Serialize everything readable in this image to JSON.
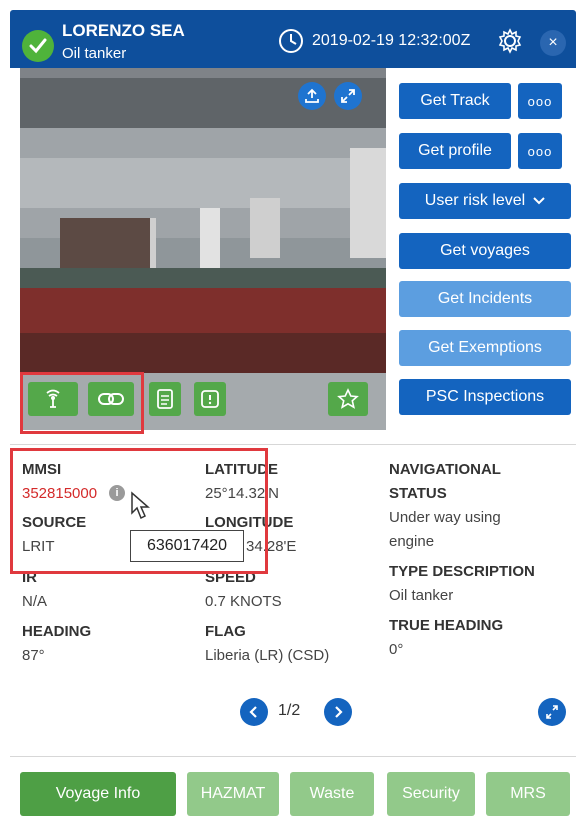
{
  "header": {
    "vessel_name": "LORENZO SEA",
    "vessel_type": "Oil tanker",
    "timestamp": "2019-02-19 12:32:00Z",
    "icons": [
      "check-icon",
      "clock-icon",
      "gear-icon",
      "close-icon"
    ],
    "close_glyph": "×"
  },
  "photo": {
    "overlay_icons": [
      "upload-icon",
      "expand-icon"
    ],
    "tool_icons": [
      "antenna-icon",
      "link-icon",
      "document-icon",
      "info-square-icon",
      "star-icon"
    ]
  },
  "actions": {
    "get_track": "Get Track",
    "get_profile": "Get profile",
    "more_glyph": "ooo",
    "user_risk_level": "User risk level",
    "get_voyages": "Get voyages",
    "get_incidents": "Get Incidents",
    "get_exemptions": "Get Exemptions",
    "psc_inspections": "PSC Inspections"
  },
  "details": {
    "mmsi_label": "MMSI",
    "mmsi_value": "352815000",
    "source_label": "SOURCE",
    "source_value": "LRIT",
    "ir_label": "IR",
    "ir_value": "N/A",
    "heading_label": "HEADING",
    "heading_value": "87°",
    "latitude_label": "LATITUDE",
    "latitude_value": "25°14.32'N",
    "longitude_label": "LONGITUDE",
    "longitude_value": "34.28'E",
    "speed_label": "SPEED",
    "speed_value": "0.7 KNOTS",
    "flag_label": "FLAG",
    "flag_value": "Liberia (LR) (CSD)",
    "nav_status_label_1": "NAVIGATIONAL",
    "nav_status_label_2": "STATUS",
    "nav_status_value_1": "Under way using",
    "nav_status_value_2": "engine",
    "type_desc_label": "TYPE DESCRIPTION",
    "type_desc_value": "Oil tanker",
    "true_heading_label": "TRUE HEADING",
    "true_heading_value": "0°",
    "tooltip": "636017420"
  },
  "pager": {
    "text": "1/2"
  },
  "tabs": {
    "voyage_info": "Voyage Info",
    "hazmat": "HAZMAT",
    "waste": "Waste",
    "security": "Security",
    "mrs": "MRS"
  },
  "colors": {
    "header": "#0e4f9c",
    "primary_button": "#1464bf",
    "disabled_button": "#5c9ee0",
    "green": "#54a84a",
    "highlight": "#e0393e",
    "mmsi_red": "#d42a2a"
  }
}
